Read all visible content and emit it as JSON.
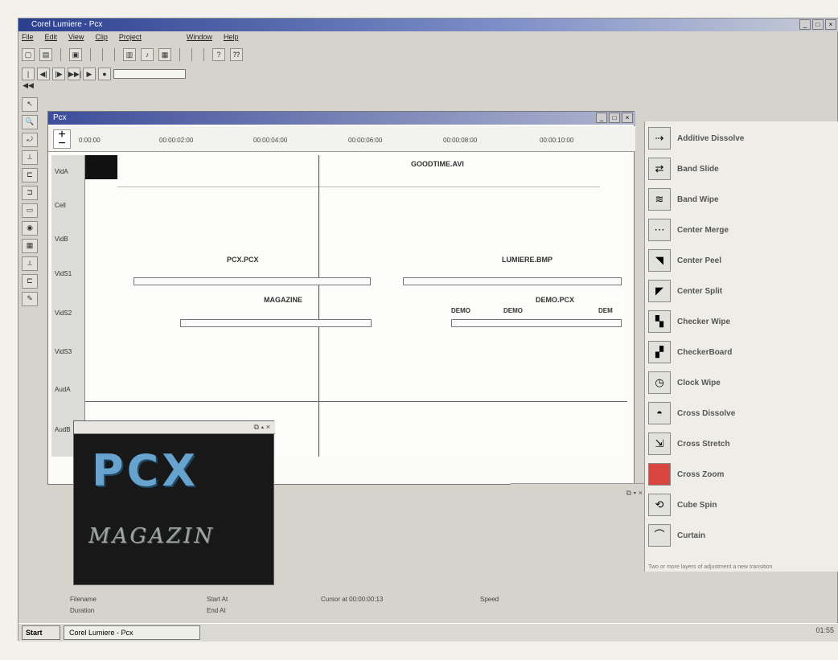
{
  "window": {
    "title": "Corel Lumiere - Pcx",
    "min": "_",
    "max": "□",
    "close": "×"
  },
  "menu": [
    "File",
    "Edit",
    "View",
    "Clip",
    "Project",
    "Window",
    "Help"
  ],
  "toolbar": {
    "new_icon": "file-new-icon",
    "open_icon": "folder-open-icon",
    "save_icon": "save-icon",
    "help_icon": "help-icon"
  },
  "transport": {
    "first": "|◀◀",
    "prev": "◀|",
    "next": "|▶",
    "last": "▶▶|",
    "play": "▶",
    "record": "●"
  },
  "left_tools": [
    "↖",
    "🔍",
    "⤾",
    "⟂",
    "⊏",
    "⊐",
    "▭",
    "◉",
    "▦",
    "⟂",
    "⊏",
    "✎"
  ],
  "timeline": {
    "title": "Pcx",
    "zoom_plus": "+",
    "zoom_minus": "−",
    "ruler_labels": [
      "0:00:00",
      "00:00:02:00",
      "00:00:04:00",
      "00:00:06:00",
      "00:00:08:00",
      "00:00:10:00"
    ],
    "tracks": [
      "VidA",
      "Cell",
      "VidB",
      "VidS1",
      "VidS2",
      "VidS3",
      "AudA",
      "AudB"
    ],
    "clips": {
      "goodtime": "GOODTIME.AVI",
      "pcx": "PCX.PCX",
      "lumiere": "LUMIERE.BMP",
      "magazine": "MAGAZINE",
      "demo": "DEMO.PCX",
      "demo_small1": "DEMO",
      "demo_small2": "DEMO",
      "demo_small3": "DEM"
    }
  },
  "preview": {
    "controls": "⧉ ▴ ×",
    "text_big": "PCX",
    "text_small": "MAGAZIN"
  },
  "small_window_controls": "⧉ ▾ ×",
  "transitions": [
    "Additive Dissolve",
    "Band Slide",
    "Band Wipe",
    "Center Merge",
    "Center Peel",
    "Center Split",
    "Checker Wipe",
    "CheckerBoard",
    "Clock Wipe",
    "Cross Dissolve",
    "Cross Stretch",
    "Cross Zoom",
    "Cube Spin",
    "Curtain"
  ],
  "panel_footer": "Two or more layers of adjustment a new transition",
  "status": {
    "filename": "Filename",
    "duration": "Duration",
    "start_at": "Start At",
    "end_at": "End At",
    "cursor": "Cursor at 00:00:00:13",
    "speed": "Speed"
  },
  "taskbar": {
    "start": "Start",
    "app": "Corel Lumiere - Pcx",
    "clock": "01:55"
  }
}
